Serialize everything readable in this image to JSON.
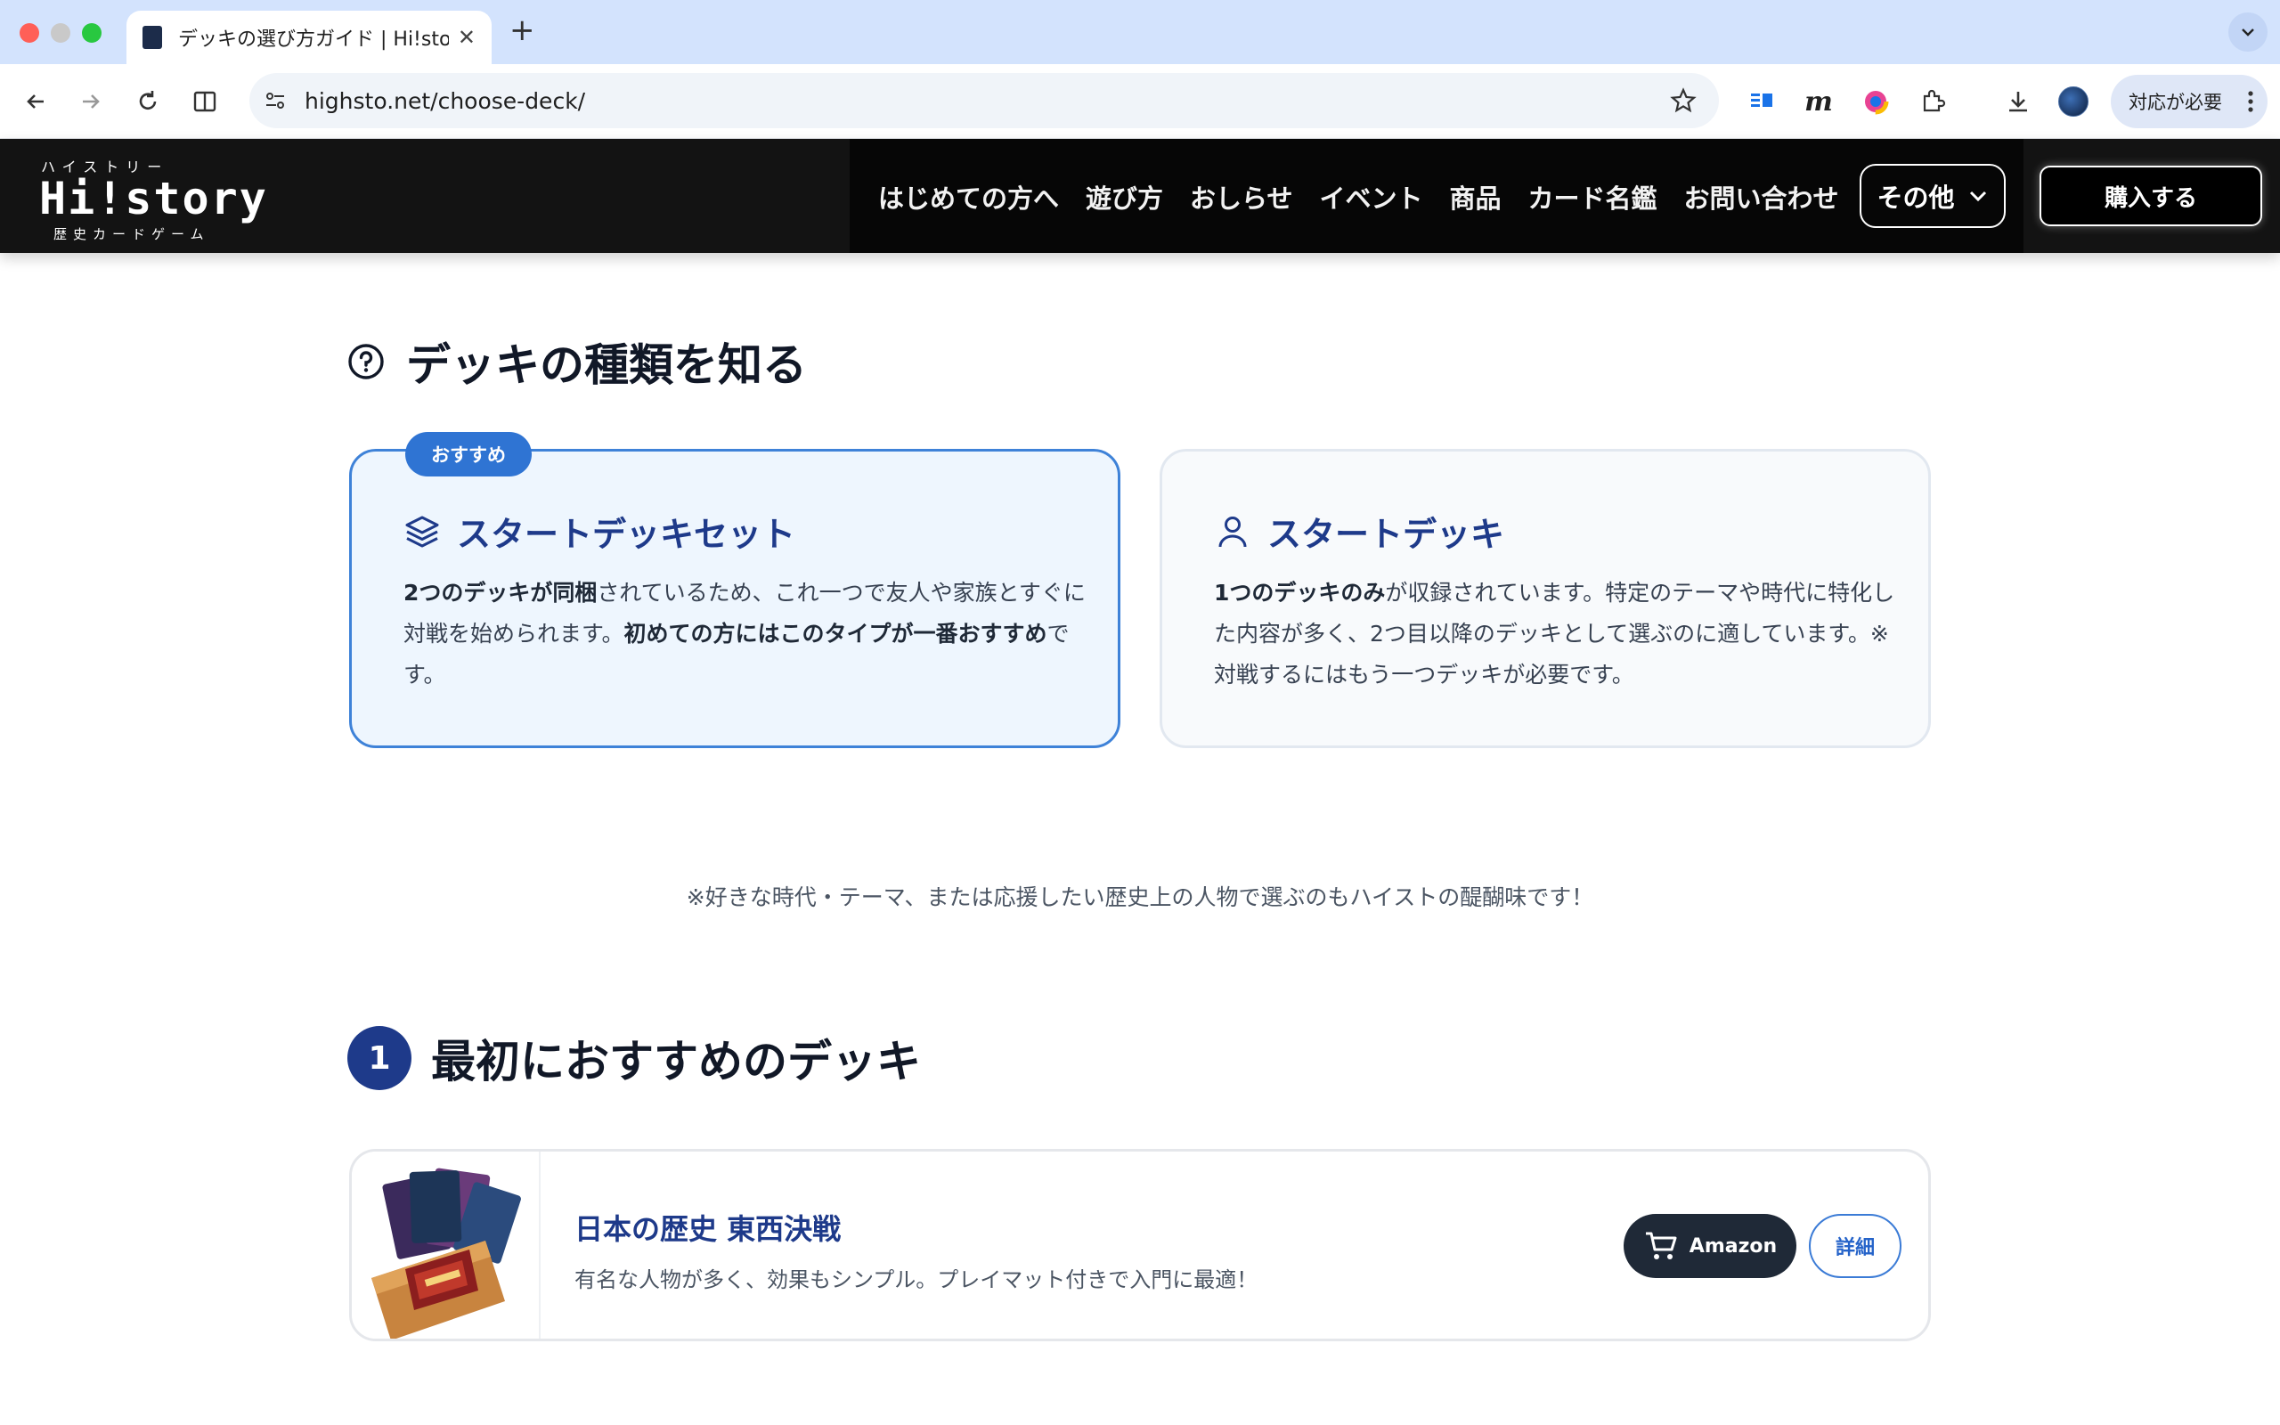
{
  "browser": {
    "tab_title": "デッキの選び方ガイド | Hi!story",
    "url": "highsto.net/choose-deck/",
    "profile_alert": "対応が必要"
  },
  "site": {
    "logo_kana": "ハイストリー",
    "logo_main": "Hi!story",
    "logo_sub": "歴史カードゲーム",
    "nav": [
      "はじめての方へ",
      "遊び方",
      "おしらせ",
      "イベント",
      "商品",
      "カード名鑑",
      "お問い合わせ"
    ],
    "other_label": "その他",
    "buy_label": "購入する"
  },
  "section_types": {
    "heading": "デッキの種類を知る",
    "recommended_card": {
      "badge": "おすすめ",
      "title": "スタートデッキセット",
      "body_b1": "2つのデッキが同梱",
      "body_t1": "されているため、これ一つで友人や家族とすぐに対戦を始められます。",
      "body_b2": "初めての方にはこのタイプが一番おすすめ",
      "body_t2": "です。"
    },
    "standard_card": {
      "title": "スタートデッキ",
      "body_b1": "1つのデッキのみ",
      "body_t1": "が収録されています。特定のテーマや時代に特化した内容が多く、2つ目以降のデッキとして選ぶのに適しています。※対戦するにはもう一つデッキが必要です。"
    },
    "note": "※好きな時代・テーマ、または応援したい歴史上の人物で選ぶのもハイストの醍醐味です！"
  },
  "section_first": {
    "number": "1",
    "heading": "最初におすすめのデッキ",
    "product": {
      "name": "日本の歴史 東西決戦",
      "description": "有名な人物が多く、効果もシンプル。プレイマット付きで入門に最適！",
      "amazon_label": "Amazon",
      "detail_label": "詳細"
    }
  }
}
